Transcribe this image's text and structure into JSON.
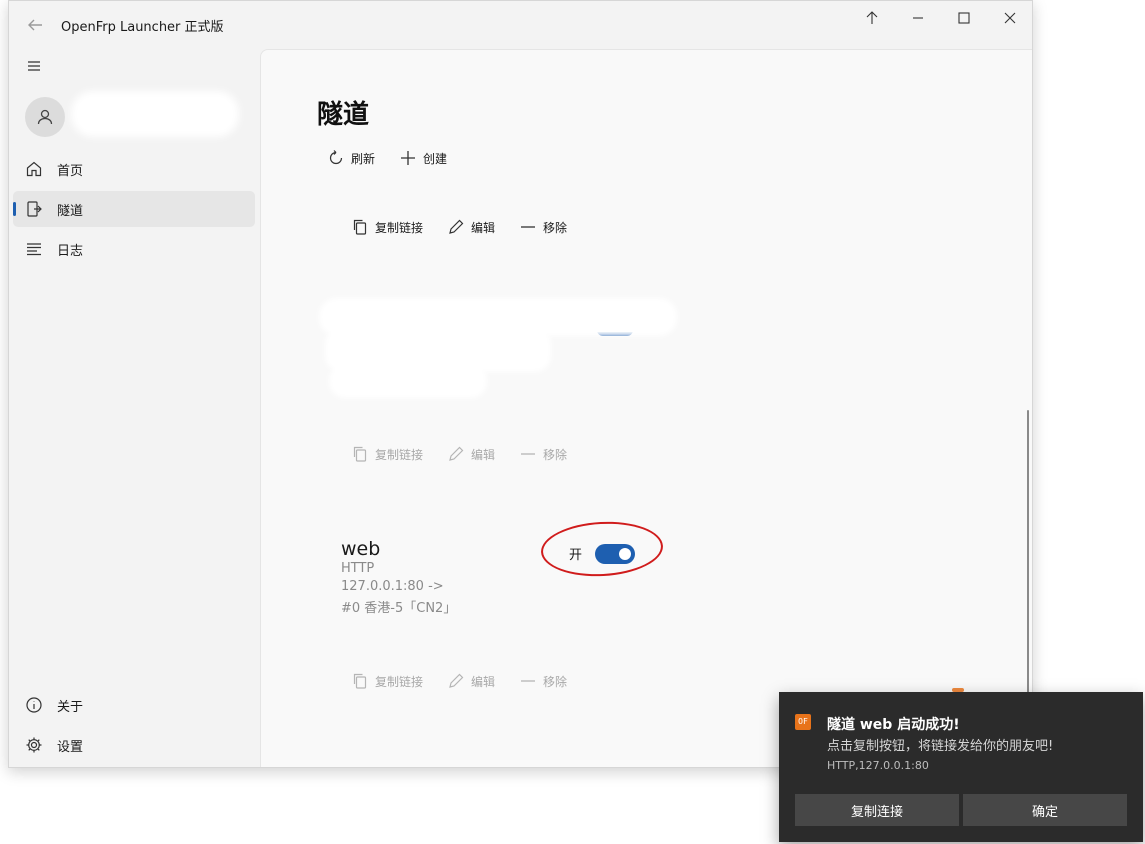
{
  "window": {
    "title": "OpenFrp Launcher 正式版",
    "controls": [
      "pin-on-top",
      "minimize",
      "maximize",
      "close"
    ]
  },
  "sidebar": {
    "items": [
      {
        "label": "首页",
        "icon": "home-icon",
        "active": false
      },
      {
        "label": "隧道",
        "icon": "tunnel-icon",
        "active": true
      },
      {
        "label": "日志",
        "icon": "log-icon",
        "active": false
      }
    ],
    "footer": [
      {
        "label": "关于",
        "icon": "info-icon"
      },
      {
        "label": "设置",
        "icon": "gear-icon"
      }
    ]
  },
  "page": {
    "title": "隧道",
    "commands": {
      "refresh": "刷新",
      "create": "创建"
    }
  },
  "card_actions": {
    "copy": "复制链接",
    "edit": "编辑",
    "remove": "移除"
  },
  "tunnels": [
    {
      "name": "web",
      "protocol": "HTTP",
      "mapping": "127.0.0.1:80 ->",
      "node": "#0 香港-5「CN2」",
      "toggle_label": "开",
      "enabled": true
    }
  ],
  "toast": {
    "title": "隧道 web 启动成功!",
    "body": "点击复制按钮，将链接发给你的朋友吧!",
    "attribution": "HTTP,127.0.0.1:80",
    "buttons": {
      "copy": "复制连接",
      "ok": "确定"
    }
  },
  "colors": {
    "accent": "#1e5fb0",
    "annotation": "#d01c1c",
    "toast_bg": "#2b2b2b"
  }
}
